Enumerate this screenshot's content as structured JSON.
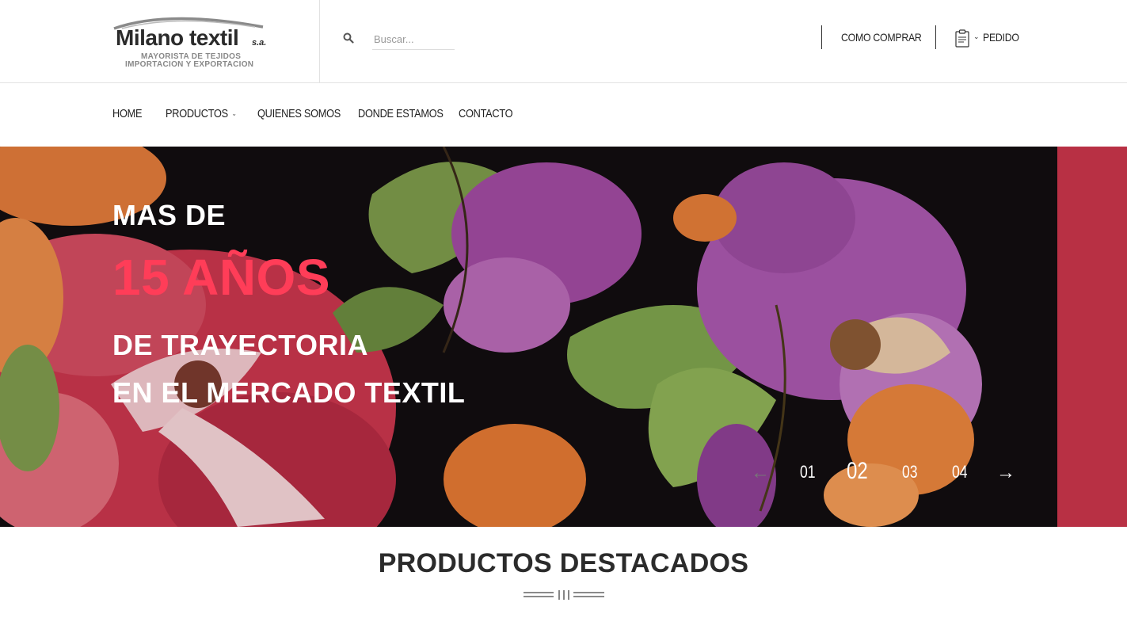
{
  "header": {
    "logo": {
      "brand": "Milano textil",
      "suffix": "s.a.",
      "tagline_1": "MAYORISTA DE TEJIDOS",
      "tagline_2": "IMPORTACION Y EXPORTACION"
    },
    "search": {
      "placeholder": "Buscar...",
      "icon": "search-icon"
    },
    "links": {
      "how_to_buy": "COMO COMPRAR",
      "order": "PEDIDO",
      "order_icon": "clipboard-icon"
    }
  },
  "nav": {
    "items": [
      {
        "label": "HOME"
      },
      {
        "label": "PRODUCTOS",
        "has_dropdown": true
      },
      {
        "label": "QUIENES SOMOS"
      },
      {
        "label": "DONDE ESTAMOS"
      },
      {
        "label": "CONTACTO"
      }
    ]
  },
  "hero": {
    "line_1": "MAS DE",
    "highlight": "15 AÑOS",
    "line_3": "DE TRAYECTORIA",
    "line_4": "EN EL MERCADO TEXTIL",
    "highlight_color": "#ff3d58",
    "slides": [
      "01",
      "02",
      "03",
      "04"
    ],
    "active_slide": "02",
    "prev_arrow": "←",
    "next_arrow": "→"
  },
  "featured": {
    "title": "PRODUCTOS DESTACADOS"
  }
}
